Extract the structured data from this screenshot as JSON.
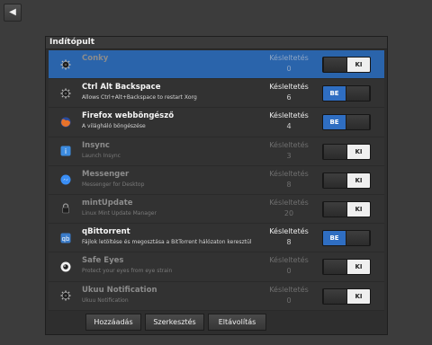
{
  "panel": {
    "title": "Indítópult"
  },
  "footer": {
    "add": "Hozzáadás",
    "edit": "Szerkesztés",
    "remove": "Eltávolítás"
  },
  "rows": [
    {
      "name": "Conky",
      "desc": "",
      "delay_label": "Késleltetés",
      "delay": "0",
      "state": "KI",
      "enabled": false,
      "selected": true,
      "icon": "gear-icon"
    },
    {
      "name": "Ctrl Alt Backspace",
      "desc": "Allows Ctrl+Alt+Backspace to restart Xorg",
      "delay_label": "Késleltetés",
      "delay": "6",
      "state": "BE",
      "enabled": true,
      "selected": false,
      "icon": "gear-icon"
    },
    {
      "name": "Firefox webböngésző",
      "desc": "A világháló böngészése",
      "delay_label": "Késleltetés",
      "delay": "4",
      "state": "BE",
      "enabled": true,
      "selected": false,
      "icon": "firefox-icon"
    },
    {
      "name": "Insync",
      "desc": "Launch Insync",
      "delay_label": "Késleltetés",
      "delay": "3",
      "state": "KI",
      "enabled": false,
      "selected": false,
      "icon": "insync-icon"
    },
    {
      "name": "Messenger",
      "desc": "Messenger for Desktop",
      "delay_label": "Késleltetés",
      "delay": "8",
      "state": "KI",
      "enabled": false,
      "selected": false,
      "icon": "messenger-icon"
    },
    {
      "name": "mintUpdate",
      "desc": "Linux Mint Update Manager",
      "delay_label": "Késleltetés",
      "delay": "20",
      "state": "KI",
      "enabled": false,
      "selected": false,
      "icon": "lock-icon"
    },
    {
      "name": "qBittorrent",
      "desc": "Fájlok letöltése és megosztása a BitTorrent hálózaton keresztül",
      "delay_label": "Késleltetés",
      "delay": "8",
      "state": "BE",
      "enabled": true,
      "selected": false,
      "icon": "qbittorrent-icon"
    },
    {
      "name": "Safe Eyes",
      "desc": "Protect your eyes from eye strain",
      "delay_label": "Késleltetés",
      "delay": "0",
      "state": "KI",
      "enabled": false,
      "selected": false,
      "icon": "eye-icon"
    },
    {
      "name": "Ukuu Notification",
      "desc": "Ukuu Notification",
      "delay_label": "Késleltetés",
      "delay": "0",
      "state": "KI",
      "enabled": false,
      "selected": false,
      "icon": "gear-icon"
    }
  ]
}
